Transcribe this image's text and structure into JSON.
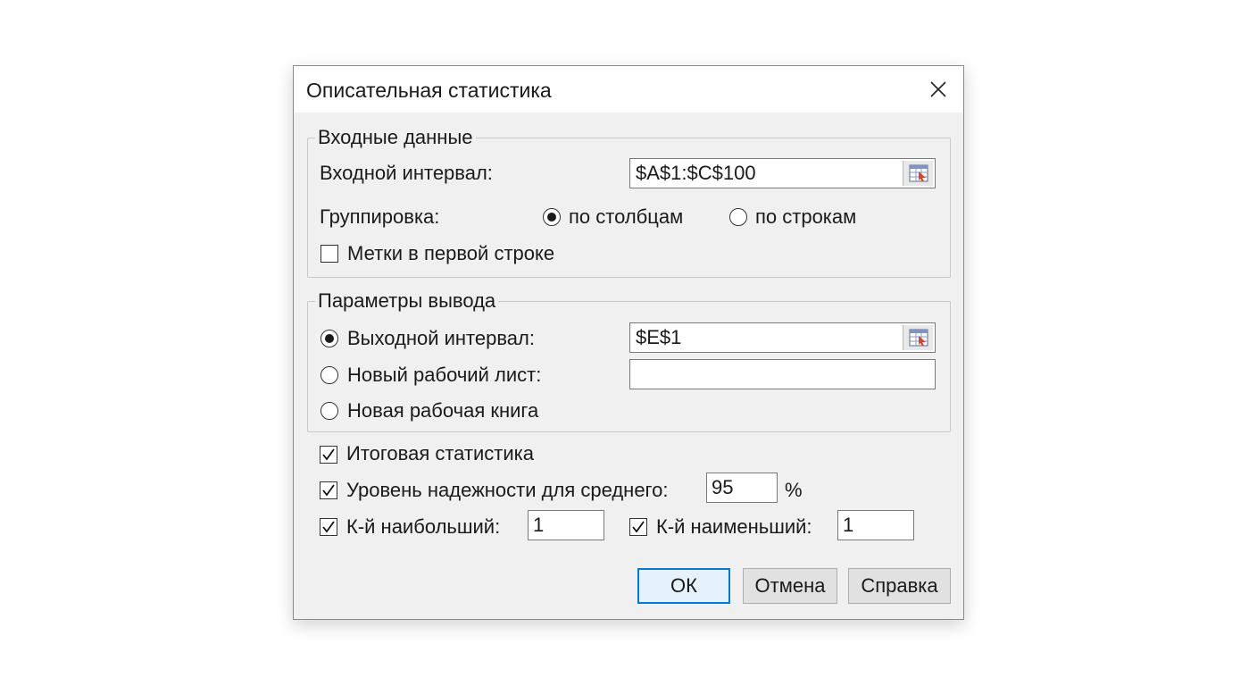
{
  "dialog": {
    "title": "Описательная статистика"
  },
  "input_group": {
    "legend": "Входные данные",
    "range_label": "Входной интервал:",
    "range_value": "$A$1:$C$100",
    "grouping_label": "Группировка:",
    "grouping_options": [
      {
        "label": "по столбцам",
        "selected": true
      },
      {
        "label": "по строкам",
        "selected": false
      }
    ],
    "labels_first_row": {
      "label": "Метки в первой строке",
      "checked": false
    }
  },
  "output_group": {
    "legend": "Параметры вывода",
    "options": [
      {
        "label": "Выходной интервал:",
        "selected": true,
        "value": "$E$1"
      },
      {
        "label": "Новый рабочий лист:",
        "selected": false,
        "value": ""
      },
      {
        "label": "Новая рабочая книга",
        "selected": false
      }
    ]
  },
  "stats": {
    "summary": {
      "label": "Итоговая статистика",
      "checked": true
    },
    "confidence": {
      "label": "Уровень надежности для среднего:",
      "checked": true,
      "value": "95",
      "unit": "%"
    },
    "kth_largest": {
      "label": "К-й наибольший:",
      "checked": true,
      "value": "1"
    },
    "kth_smallest": {
      "label": "К-й наименьший:",
      "checked": true,
      "value": "1"
    }
  },
  "buttons": {
    "ok": "ОК",
    "cancel": "Отмена",
    "help": "Справка"
  },
  "icons": {
    "close": "close-icon",
    "range_picker": "range-selector-icon",
    "checkmark": "checkmark-icon"
  }
}
